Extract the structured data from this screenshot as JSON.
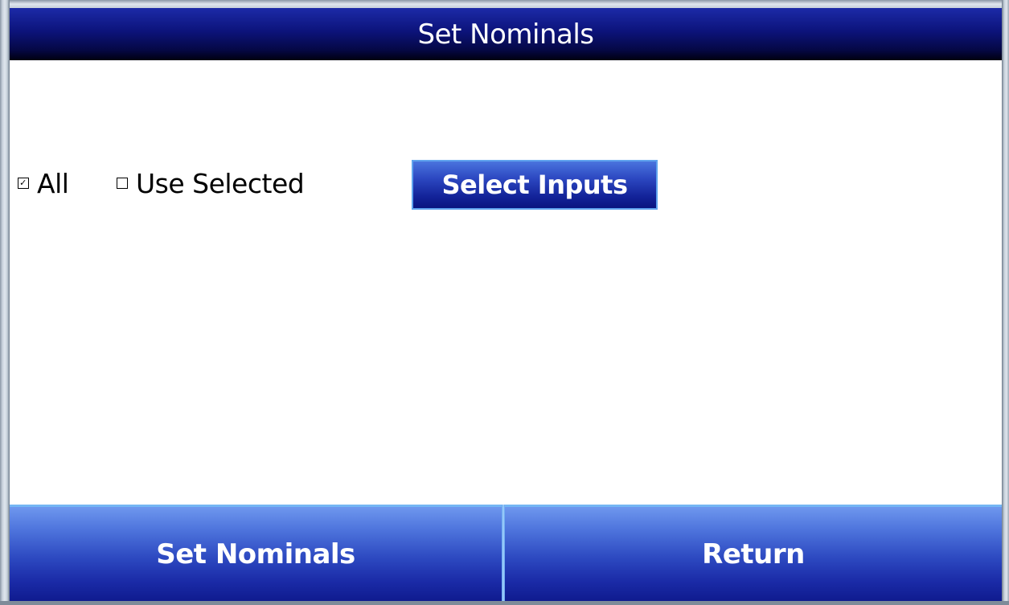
{
  "window": {
    "title": "Set Nominals"
  },
  "options": {
    "all": {
      "label": "All",
      "checked": true
    },
    "use_selected": {
      "label": "Use Selected",
      "checked": false
    }
  },
  "buttons": {
    "select_inputs": "Select Inputs",
    "set_nominals": "Set Nominals",
    "return": "Return"
  },
  "colors": {
    "title_bar": "#0c137a",
    "button_blue": "#2d49c2",
    "button_border": "#74b6f4",
    "text": "#000000",
    "background": "#ffffff"
  }
}
